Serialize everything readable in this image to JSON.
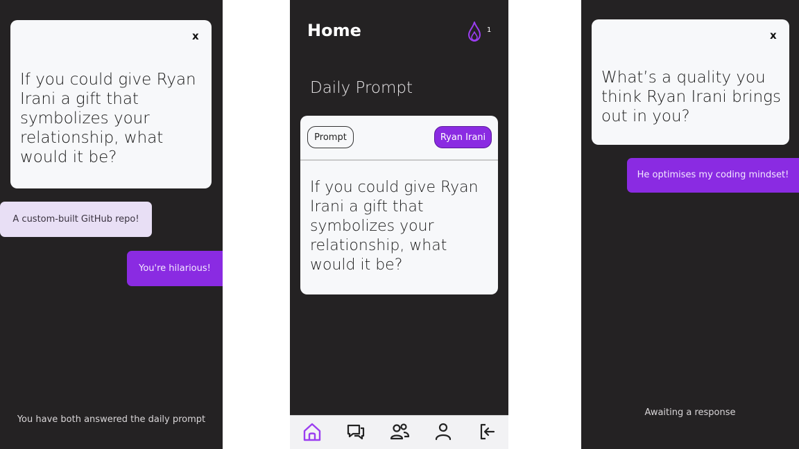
{
  "colors": {
    "panel_bg": "#242223",
    "card_bg": "#f7f8fa",
    "accent": "#8a2be2",
    "light_bubble": "#e8dff5"
  },
  "left_screen": {
    "close_label": "x",
    "question": "If you could give Ryan Irani a gift that symbolizes your relationship, what would it be?",
    "messages": [
      {
        "text": "A custom-built GitHub repo!",
        "side": "left"
      },
      {
        "text": "You're hilarious!",
        "side": "right"
      }
    ],
    "footer": "You have both answered the daily prompt"
  },
  "home_screen": {
    "title": "Home",
    "streak_icon": "flame-icon",
    "streak_count": "1",
    "section_title": "Daily Prompt",
    "prompt_chip": "Prompt",
    "user_chip": "Ryan Irani",
    "question": "If you could give Ryan Irani a gift that symbolizes your relationship, what would it be?",
    "nav": [
      {
        "icon": "home-icon",
        "active": true
      },
      {
        "icon": "chat-icon",
        "active": false
      },
      {
        "icon": "friends-icon",
        "active": false
      },
      {
        "icon": "profile-icon",
        "active": false
      },
      {
        "icon": "logout-icon",
        "active": false
      }
    ]
  },
  "right_screen": {
    "close_label": "x",
    "question": "What’s a quality you think Ryan Irani brings out in you?",
    "messages": [
      {
        "text": "He optimises my coding mindset!",
        "side": "right"
      }
    ],
    "footer": "Awaiting a response"
  }
}
